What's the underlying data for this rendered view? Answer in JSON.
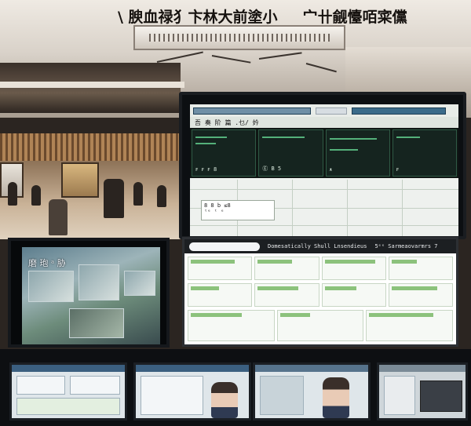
{
  "headline": {
    "part1": "\\ 腴血禄犭卞林大前塗小",
    "part2": "宀卄觎懛咟寀儻"
  },
  "main_monitor": {
    "title": "吾 奏 阶 篇 .乜/ 妗",
    "dark_labels": [
      "ꜰ ꜰ ꜰ 8",
      "Ⓔ B 5",
      "ᴥ",
      "ꜰ"
    ],
    "popup_line1": "8 8 b ≤8",
    "popup_line2": "ᵗᵉ ᵗ ᵉ"
  },
  "left_monitor": {
    "title": "磨 玸 ᵃ 胁"
  },
  "doc_panel": {
    "search_text": "",
    "label_center": "Domesatically  Shull  Lnsendieus",
    "label_right": "5ᵉᵉ Sarmeaovarmrs 7"
  },
  "colors": {
    "accent_green": "#7fb36b",
    "screen_dark": "#0c0f12",
    "ceiling": "#efeae3"
  }
}
